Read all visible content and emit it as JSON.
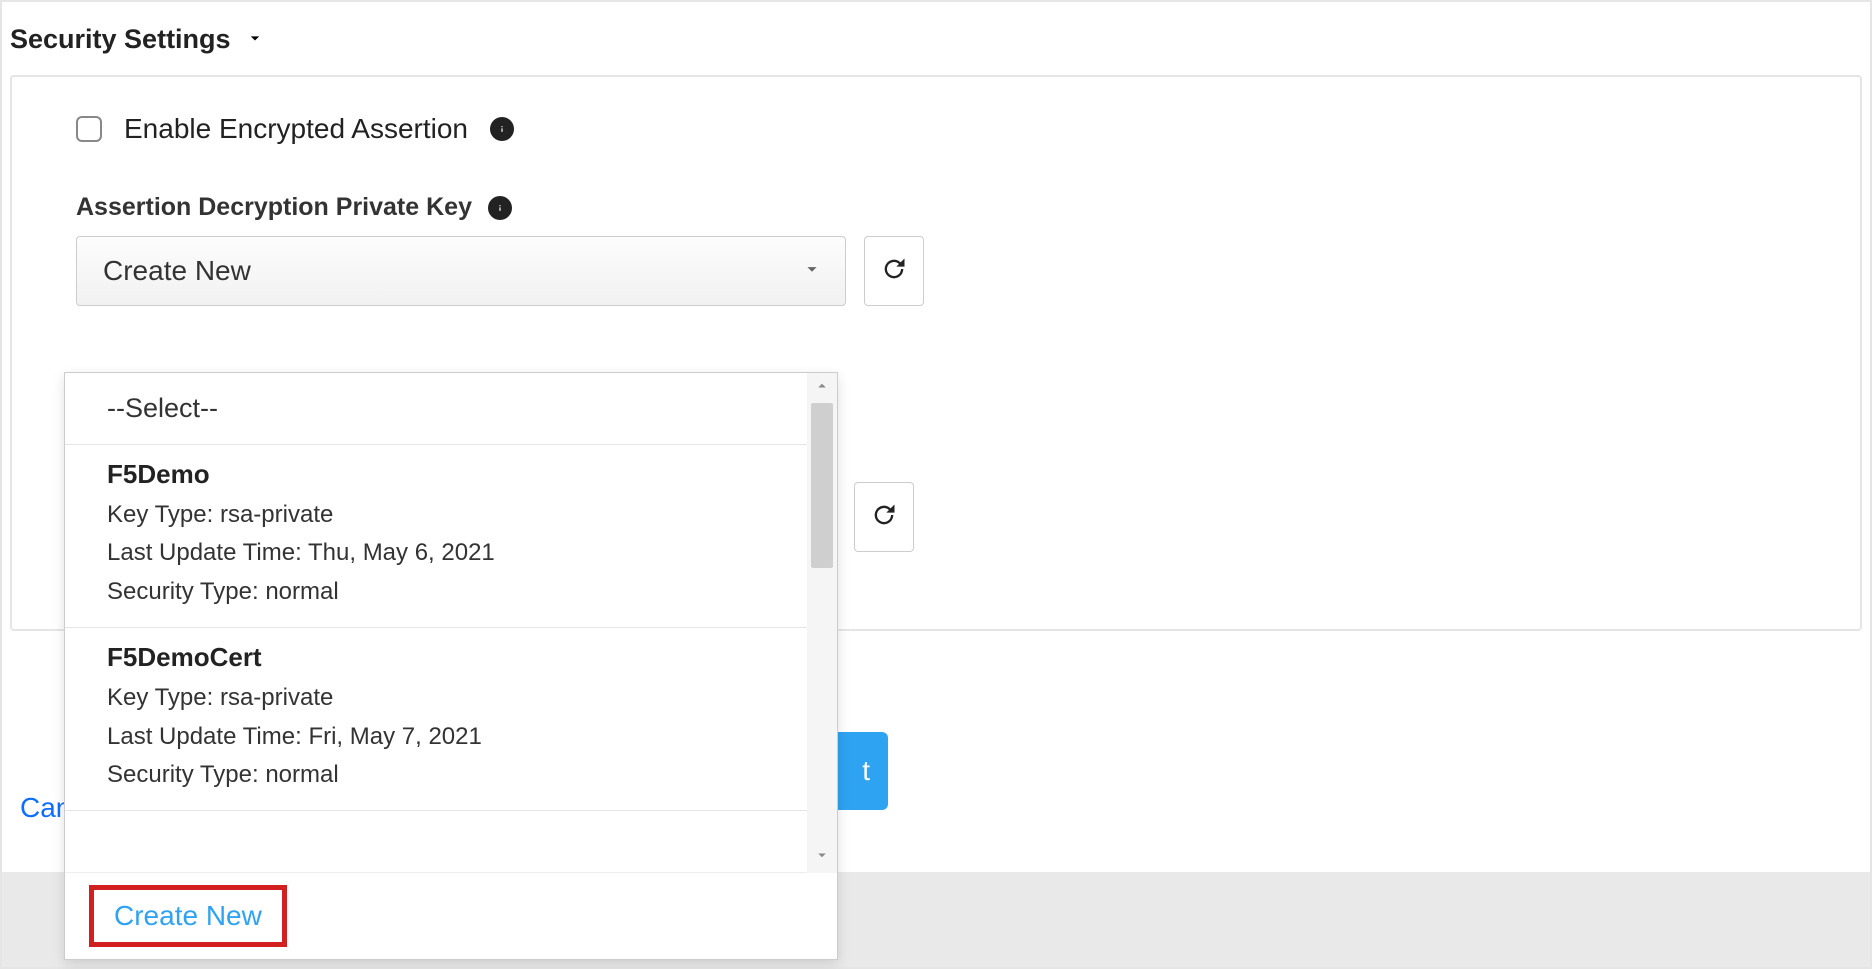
{
  "section": {
    "title": "Security Settings"
  },
  "enable_encrypted": {
    "label": "Enable Encrypted Assertion",
    "checked": false
  },
  "decrypt_key": {
    "label": "Assertion Decryption Private Key",
    "select_value": "Create New",
    "dropdown": {
      "placeholder": "--Select--",
      "options": [
        {
          "name": "F5Demo",
          "key_type_label": "Key Type:",
          "key_type": "rsa-private",
          "last_update_label": "Last Update Time:",
          "last_update": "Thu, May 6, 2021",
          "security_type_label": "Security Type:",
          "security_type": "normal"
        },
        {
          "name": "F5DemoCert",
          "key_type_label": "Key Type:",
          "key_type": "rsa-private",
          "last_update_label": "Last Update Time:",
          "last_update": "Fri, May 7, 2021",
          "security_type_label": "Security Type:",
          "security_type": "normal"
        }
      ],
      "create_new": "Create New"
    }
  },
  "footer": {
    "cancel": "Can",
    "next": "t"
  }
}
